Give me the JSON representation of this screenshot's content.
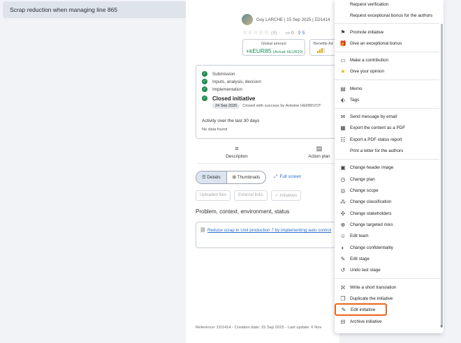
{
  "window": {
    "title": "Scrap reduction when managing line 865"
  },
  "author": {
    "name": "Guy LARCHE",
    "date": "15 Sep 2025",
    "ref": "ΣD1414",
    "separator": "|"
  },
  "rating": {
    "stars": "☆☆☆☆☆",
    "count": "(0)",
    "comments": "0",
    "links": "5"
  },
  "amount": {
    "label": "Global amount",
    "value": "+kEUR85",
    "actual": "(Actual: kEUR20)"
  },
  "benefits": {
    "label": "Benefits",
    "cut": "Ad"
  },
  "timeline": {
    "steps": [
      "Submission",
      "Inputs, analysis, decision",
      "Implementation",
      "Closed initiative"
    ],
    "closed_date": "24 Sep 2025",
    "closed_note": "Closed with success by Antoine HERBIVOT",
    "activity_title": "Activity over the last 30 days",
    "activity_empty": "No data found"
  },
  "tabs": {
    "description": "Description",
    "action_plan": "Action plan"
  },
  "view": {
    "details": "Details",
    "thumbnails": "Thumbnails",
    "fullscreen": "Full screen"
  },
  "filters": [
    "Uploaded files",
    "External links",
    "Initiatives"
  ],
  "section": {
    "title": "Problem, context, environment, status"
  },
  "link": {
    "text": "Reduce scrap in Unit production 7 by implementing auto control"
  },
  "footer": {
    "text": "Reference: ΣD1414 - Creation date: 15 Sep 2025 - Last update: 6 Nov"
  },
  "menu": {
    "items": [
      {
        "label": "Request verification",
        "icon": ""
      },
      {
        "label": "Request exceptional bonus for the authors",
        "icon": ""
      },
      {
        "label": "Promote initiative",
        "icon": "flag-icon"
      },
      {
        "label": "Give an exceptional bonus",
        "icon": "gift-icon"
      },
      {
        "label": "Make a contribution",
        "icon": "comment-icon"
      },
      {
        "label": "Give your opinion",
        "icon": "star-icon"
      },
      {
        "label": "Memo",
        "icon": "memo-icon"
      },
      {
        "label": "Tags",
        "icon": "tag-icon"
      },
      {
        "label": "Send message by email",
        "icon": "mail-icon"
      },
      {
        "label": "Export the content as a PDF",
        "icon": "pdf-icon"
      },
      {
        "label": "Export a PDF status report",
        "icon": "report-icon"
      },
      {
        "label": "Print a letter for the authors",
        "icon": ""
      },
      {
        "label": "Change header image",
        "icon": "image-icon"
      },
      {
        "label": "Change plan",
        "icon": "plan-icon"
      },
      {
        "label": "Change scope",
        "icon": "scope-icon"
      },
      {
        "label": "Change classification",
        "icon": "classification-icon"
      },
      {
        "label": "Change stakeholders",
        "icon": "stakeholders-icon"
      },
      {
        "label": "Change targeted risks",
        "icon": "risks-icon"
      },
      {
        "label": "Edit team",
        "icon": "team-icon"
      },
      {
        "label": "Change confidentiality",
        "icon": "confidentiality-icon"
      },
      {
        "label": "Edit stage",
        "icon": "pencil-icon"
      },
      {
        "label": "Undo last stage",
        "icon": "undo-icon"
      },
      {
        "label": "Write a short translation",
        "icon": "translate-icon"
      },
      {
        "label": "Duplicate the initiative",
        "icon": "duplicate-icon"
      },
      {
        "label": "Edit initiative",
        "icon": "pencil-icon"
      },
      {
        "label": "Archive initiative",
        "icon": "archive-icon"
      }
    ]
  },
  "colors": {
    "accent": "#2a6cc7",
    "success": "#1c8d4a",
    "highlight": "#e8661d"
  }
}
